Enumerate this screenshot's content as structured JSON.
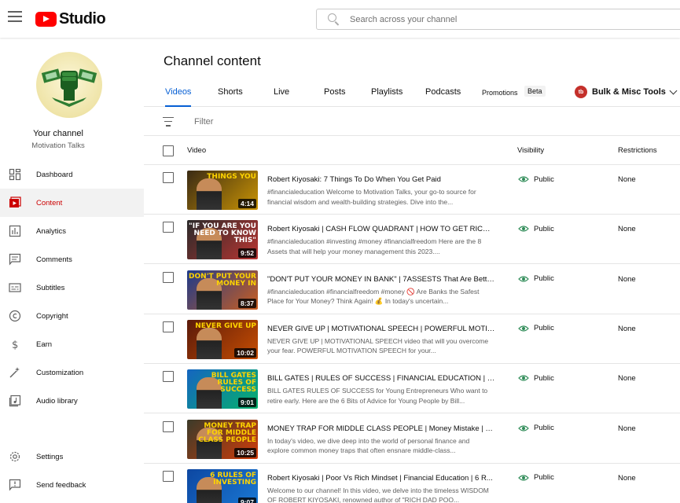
{
  "app": {
    "logo_text": "Studio",
    "search_placeholder": "Search across your channel"
  },
  "sidebar": {
    "channel_label": "Your channel",
    "channel_name": "Motivation Talks",
    "items": [
      {
        "label": "Dashboard",
        "icon": "dashboard-icon"
      },
      {
        "label": "Content",
        "icon": "content-icon",
        "active": true
      },
      {
        "label": "Analytics",
        "icon": "analytics-icon"
      },
      {
        "label": "Comments",
        "icon": "comments-icon"
      },
      {
        "label": "Subtitles",
        "icon": "subtitles-icon"
      },
      {
        "label": "Copyright",
        "icon": "copyright-icon"
      },
      {
        "label": "Earn",
        "icon": "earn-icon"
      },
      {
        "label": "Customization",
        "icon": "customization-icon"
      },
      {
        "label": "Audio library",
        "icon": "audio-library-icon"
      }
    ],
    "bottom_items": [
      {
        "label": "Settings",
        "icon": "gear-icon"
      },
      {
        "label": "Send feedback",
        "icon": "feedback-icon"
      }
    ]
  },
  "main": {
    "title": "Channel content",
    "tabs": [
      "Videos",
      "Shorts",
      "Live",
      "Posts",
      "Playlists",
      "Podcasts",
      "Promotions"
    ],
    "beta_badge": "Beta",
    "bulk_tools": "Bulk & Misc Tools",
    "bulk_logo": "tb",
    "filter_placeholder": "Filter",
    "columns": {
      "video": "Video",
      "visibility": "Visibility",
      "restrictions": "Restrictions"
    }
  },
  "videos": [
    {
      "title": "Robert Kiyosaki: 7 Things To Do When You Get Paid",
      "description": "#financialeducation Welcome to Motivation Talks, your go-to source for financial wisdom and wealth-building strategies. Dive into the...",
      "duration": "4:14",
      "thumb_text": "THINGS YOU",
      "visibility": "Public",
      "restrictions": "None",
      "colors": {
        "bg": "#3a2a14",
        "accent": "#f5b400",
        "text": "#ffd400"
      }
    },
    {
      "title": "Robert Kiyosaki | CASH FLOW QUADRANT | HOW TO GET RICH | ...",
      "description": "#financialeducation #investing #money #financialfreedom Here are the 8 Assets that will help your money management this 2023....",
      "duration": "9:52",
      "thumb_text": "\"IF YOU ARE YOU NEED TO KNOW THIS\"",
      "visibility": "Public",
      "restrictions": "None",
      "colors": {
        "bg": "#2a2a2a",
        "accent": "#e53935",
        "text": "#ffffff"
      }
    },
    {
      "title": "\"DON'T PUT YOUR MONEY IN BANK\" | 7ASSESTS That Are Better ...",
      "description": "#financialeducation #financialfreedom #money 🚫 Are Banks the Safest Place for Your Money? Think Again! 💰 In today's uncertain...",
      "duration": "8:37",
      "thumb_text": "DON'T PUT YOUR MONEY IN",
      "visibility": "Public",
      "restrictions": "None",
      "colors": {
        "bg": "#1e3a8a",
        "accent": "#ff6a00",
        "text": "#ffd400"
      }
    },
    {
      "title": "NEVER GIVE UP | MOTIVATIONAL SPEECH | POWERFUL MOTIVA...",
      "description": "NEVER GIVE UP | MOTIVATIONAL SPEECH video that will you overcome your fear. POWERFUL MOTIVATION SPEECH for your...",
      "duration": "10:02",
      "thumb_text": "NEVER GIVE UP",
      "visibility": "Public",
      "restrictions": "None",
      "colors": {
        "bg": "#5a1a0a",
        "accent": "#e85d00",
        "text": "#ffd400"
      }
    },
    {
      "title": "BILL GATES | RULES OF SUCCESS | FINANCIAL EDUCATION | #bil...",
      "description": "BILL GATES RULES OF SUCCESS for Young Entrepreneurs Who want to retire early. Here are the 6 Bits of Advice for Young People by Bill...",
      "duration": "9:01",
      "thumb_text": "BILL GATES RULES OF SUCCESS",
      "visibility": "Public",
      "restrictions": "None",
      "colors": {
        "bg": "#1565c0",
        "accent": "#00c853",
        "text": "#ffd400"
      }
    },
    {
      "title": "MONEY TRAP FOR MIDDLE CLASS PEOPLE | Money Mistake | M...",
      "description": "In today's video, we dive deep into the world of personal finance and explore common money traps that often ensnare middle-class...",
      "duration": "10:25",
      "thumb_text": "MONEY TRAP FOR MIDDLE CLASS PEOPLE",
      "visibility": "Public",
      "restrictions": "None",
      "colors": {
        "bg": "#3b3b2a",
        "accent": "#ff3d00",
        "text": "#ffd400"
      }
    },
    {
      "title": "Robert Kiyosaki | Poor Vs Rich Mindset | Financial Education | 6 R...",
      "description": "Welcome to our channel! In this video, we delve into the timeless WISDOM OF ROBERT KIYOSAKI, renowned author of \"RICH DAD POO...",
      "duration": "9:07",
      "thumb_text": "6 RULES OF INVESTING",
      "visibility": "Public",
      "restrictions": "None",
      "colors": {
        "bg": "#0d47a1",
        "accent": "#1e88e5",
        "text": "#ffd400"
      }
    }
  ]
}
